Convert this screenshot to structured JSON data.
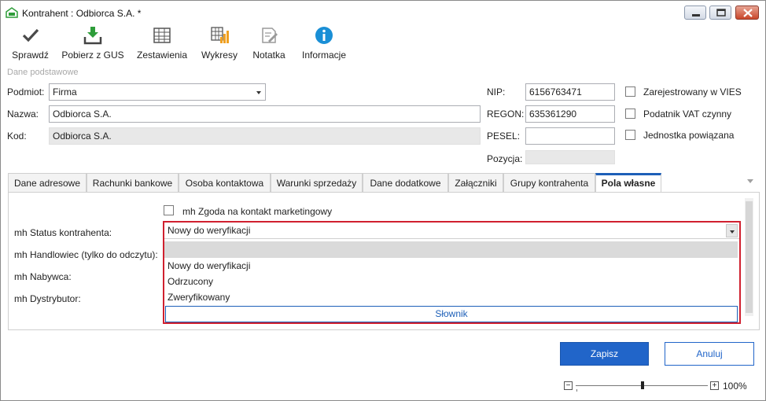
{
  "window": {
    "title": "Kontrahent : Odbiorca S.A. *"
  },
  "toolbar": {
    "items": [
      {
        "label": "Sprawdź",
        "icon": "check-icon"
      },
      {
        "label": "Pobierz z GUS",
        "icon": "download-icon"
      },
      {
        "label": "Zestawienia",
        "icon": "table-icon"
      },
      {
        "label": "Wykresy",
        "icon": "chart-icon"
      },
      {
        "label": "Notatka",
        "icon": "note-icon"
      },
      {
        "label": "Informacje",
        "icon": "info-icon"
      }
    ]
  },
  "basic": {
    "section_caption": "Dane podstawowe",
    "podmiot_label": "Podmiot:",
    "podmiot_value": "Firma",
    "nazwa_label": "Nazwa:",
    "nazwa_value": "Odbiorca S.A.",
    "kod_label": "Kod:",
    "kod_value": "Odbiorca S.A.",
    "nip_label": "NIP:",
    "nip_value": "6156763471",
    "regon_label": "REGON:",
    "regon_value": "635361290",
    "pesel_label": "PESEL:",
    "pesel_value": "",
    "pozycja_label": "Pozycja:",
    "pozycja_value": "",
    "vies_label": "Zarejestrowany w VIES",
    "vat_label": "Podatnik VAT czynny",
    "related_label": "Jednostka powiązana"
  },
  "tabs": [
    {
      "label": "Dane adresowe"
    },
    {
      "label": "Rachunki bankowe"
    },
    {
      "label": "Osoba kontaktowa"
    },
    {
      "label": "Warunki sprzedaży"
    },
    {
      "label": "Dane dodatkowe"
    },
    {
      "label": "Załączniki"
    },
    {
      "label": "Grupy kontrahenta"
    },
    {
      "label": "Pola własne"
    }
  ],
  "active_tab": "Pola własne",
  "custom_fields": {
    "marketing_label": "mh Zgoda na kontakt marketingowy",
    "status_label": "mh Status kontrahenta:",
    "handlowiec_label": "mh Handlowiec (tylko do odczytu):",
    "nabywca_label": "mh Nabywca:",
    "dystrybutor_label": "mh Dystrybutor:",
    "status_value": "Nowy do weryfikacji",
    "options": [
      "Nowy do weryfikacji",
      "Odrzucony",
      "Zweryfikowany"
    ],
    "dictionary_button": "Słownik"
  },
  "actions": {
    "save": "Zapisz",
    "cancel": "Anuluj"
  },
  "zoom": {
    "minus": "−",
    "plus": "+",
    "value": "100%"
  },
  "colors": {
    "accent": "#2165c9",
    "highlight_border": "#d0202f",
    "gus_green": "#2e9d3a",
    "info_blue": "#1a8fd6",
    "chart_orange": "#f0a020"
  }
}
